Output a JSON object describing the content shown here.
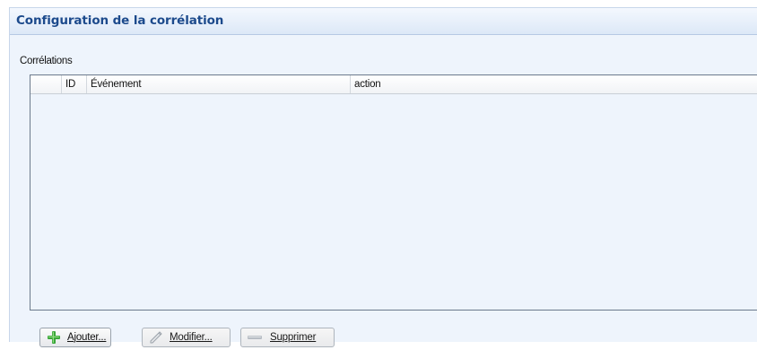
{
  "header": {
    "title": "Configuration de la corrélation"
  },
  "group": {
    "label": "Corrélations"
  },
  "table": {
    "columns": [
      {
        "key": "selector",
        "label": ""
      },
      {
        "key": "id",
        "label": "ID"
      },
      {
        "key": "evenement",
        "label": "Événement"
      },
      {
        "key": "action",
        "label": "action"
      }
    ],
    "rows": []
  },
  "buttons": {
    "add": {
      "label": "Ajouter...",
      "icon": "plus-icon",
      "enabled": true
    },
    "modify": {
      "label": "Modifier...",
      "icon": "pencil-icon",
      "enabled": false
    },
    "delete": {
      "label": "Supprimer",
      "icon": "minus-icon",
      "enabled": false
    }
  },
  "colors": {
    "title": "#1c4a8c",
    "panel_background": "#eef4fc",
    "plus_icon": "#3aa63a"
  }
}
